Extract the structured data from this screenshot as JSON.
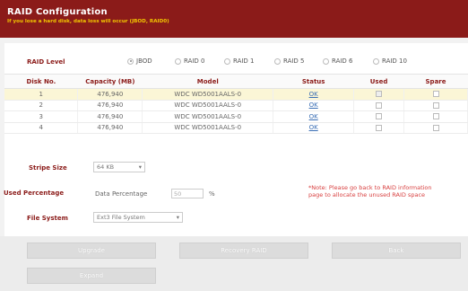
{
  "header": {
    "title": "RAID Configuration",
    "subtitle": "If you lose a hard disk, data loss will occur (JBOD, RAID0)"
  },
  "raid_level": {
    "label": "RAID Level",
    "options": [
      "JBOD",
      "RAID 0",
      "RAID 1",
      "RAID 5",
      "RAID 6",
      "RAID 10"
    ],
    "selected": "JBOD"
  },
  "table": {
    "headers": [
      "Disk No.",
      "Capacity (MB)",
      "Model",
      "Status",
      "Used",
      "Spare"
    ],
    "rows": [
      {
        "disk": "1",
        "capacity": "476,940",
        "model": "WDC WD5001AALS-0",
        "status": "OK"
      },
      {
        "disk": "2",
        "capacity": "476,940",
        "model": "WDC WD5001AALS-0",
        "status": "OK"
      },
      {
        "disk": "3",
        "capacity": "476,940",
        "model": "WDC WD5001AALS-0",
        "status": "OK"
      },
      {
        "disk": "4",
        "capacity": "476,940",
        "model": "WDC WD5001AALS-0",
        "status": "OK"
      }
    ]
  },
  "stripe": {
    "label": "Stripe Size",
    "value": "64 KB"
  },
  "used_pct": {
    "label": "Used Percentage",
    "field_label": "Data Percentage",
    "value": "50",
    "unit": "%"
  },
  "note": "*Note: Please go back to RAID information page to allocate the unused RAID space",
  "file_system": {
    "label": "File System",
    "value": "Ext3 File System"
  },
  "buttons": {
    "upgrade": "Upgrade",
    "recovery": "Recovery RAID",
    "back": "Back",
    "expand": "Expand"
  },
  "colors": {
    "brand": "#8b1b19",
    "accent_yellow": "#f2c600",
    "note_red": "#d84040"
  }
}
